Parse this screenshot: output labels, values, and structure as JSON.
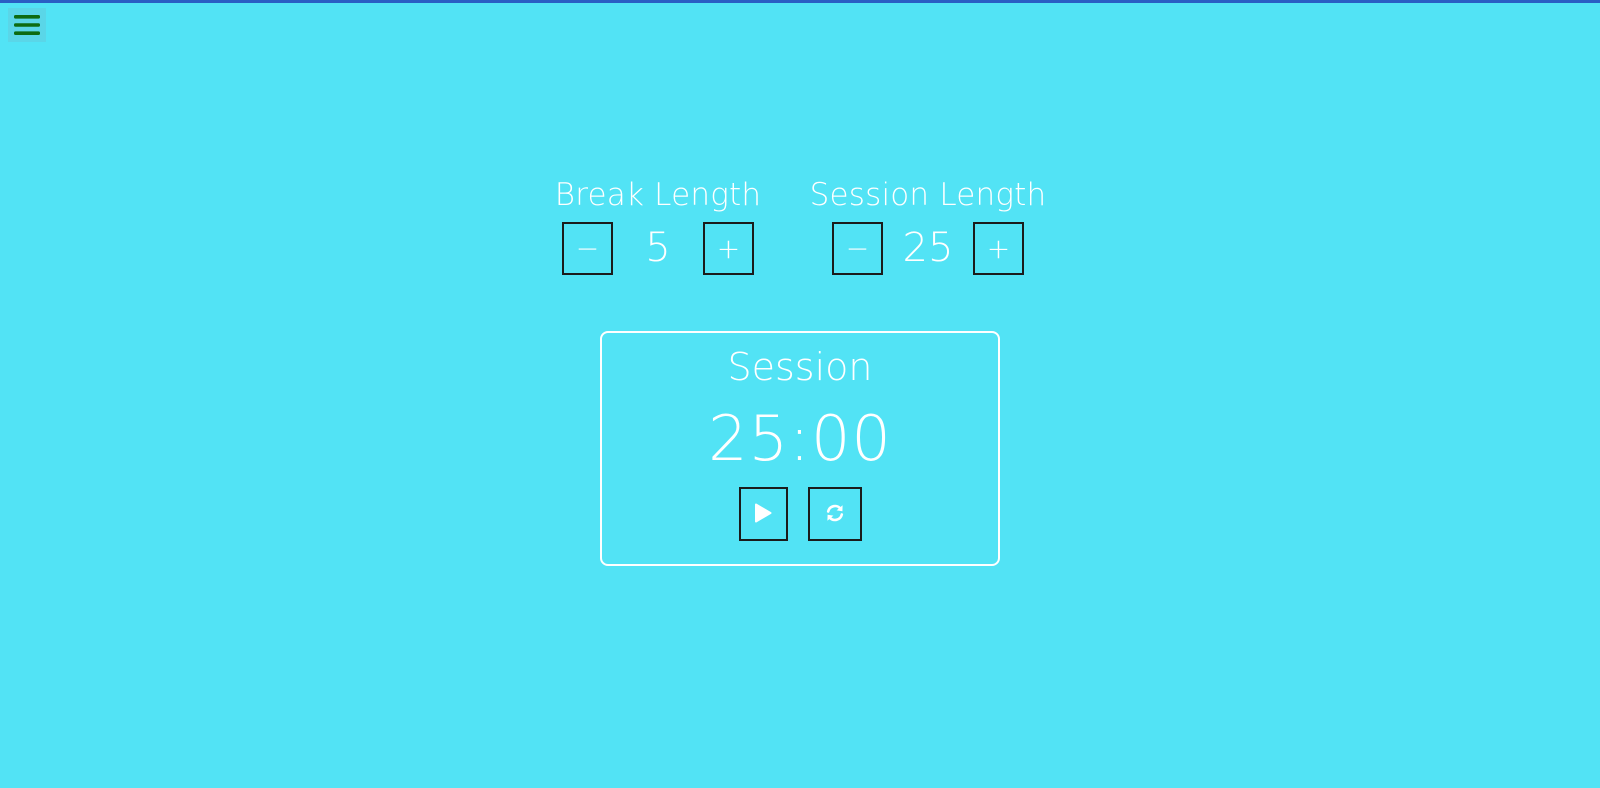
{
  "colors": {
    "background": "#52e3f5",
    "top_bar": "#2a5ec4",
    "menu_icon": "#0d6b12",
    "text": "#ffffff",
    "button_border": "#1b1b1b"
  },
  "menu": {
    "icon": "hamburger-menu-icon"
  },
  "break_length": {
    "label": "Break Length",
    "decrement_label": "−",
    "value": "5",
    "increment_label": "+"
  },
  "session_length": {
    "label": "Session Length",
    "decrement_label": "−",
    "value": "25",
    "increment_label": "+"
  },
  "timer": {
    "label": "Session",
    "display": "25:00",
    "play_icon": "play-icon",
    "reset_icon": "refresh-icon"
  }
}
